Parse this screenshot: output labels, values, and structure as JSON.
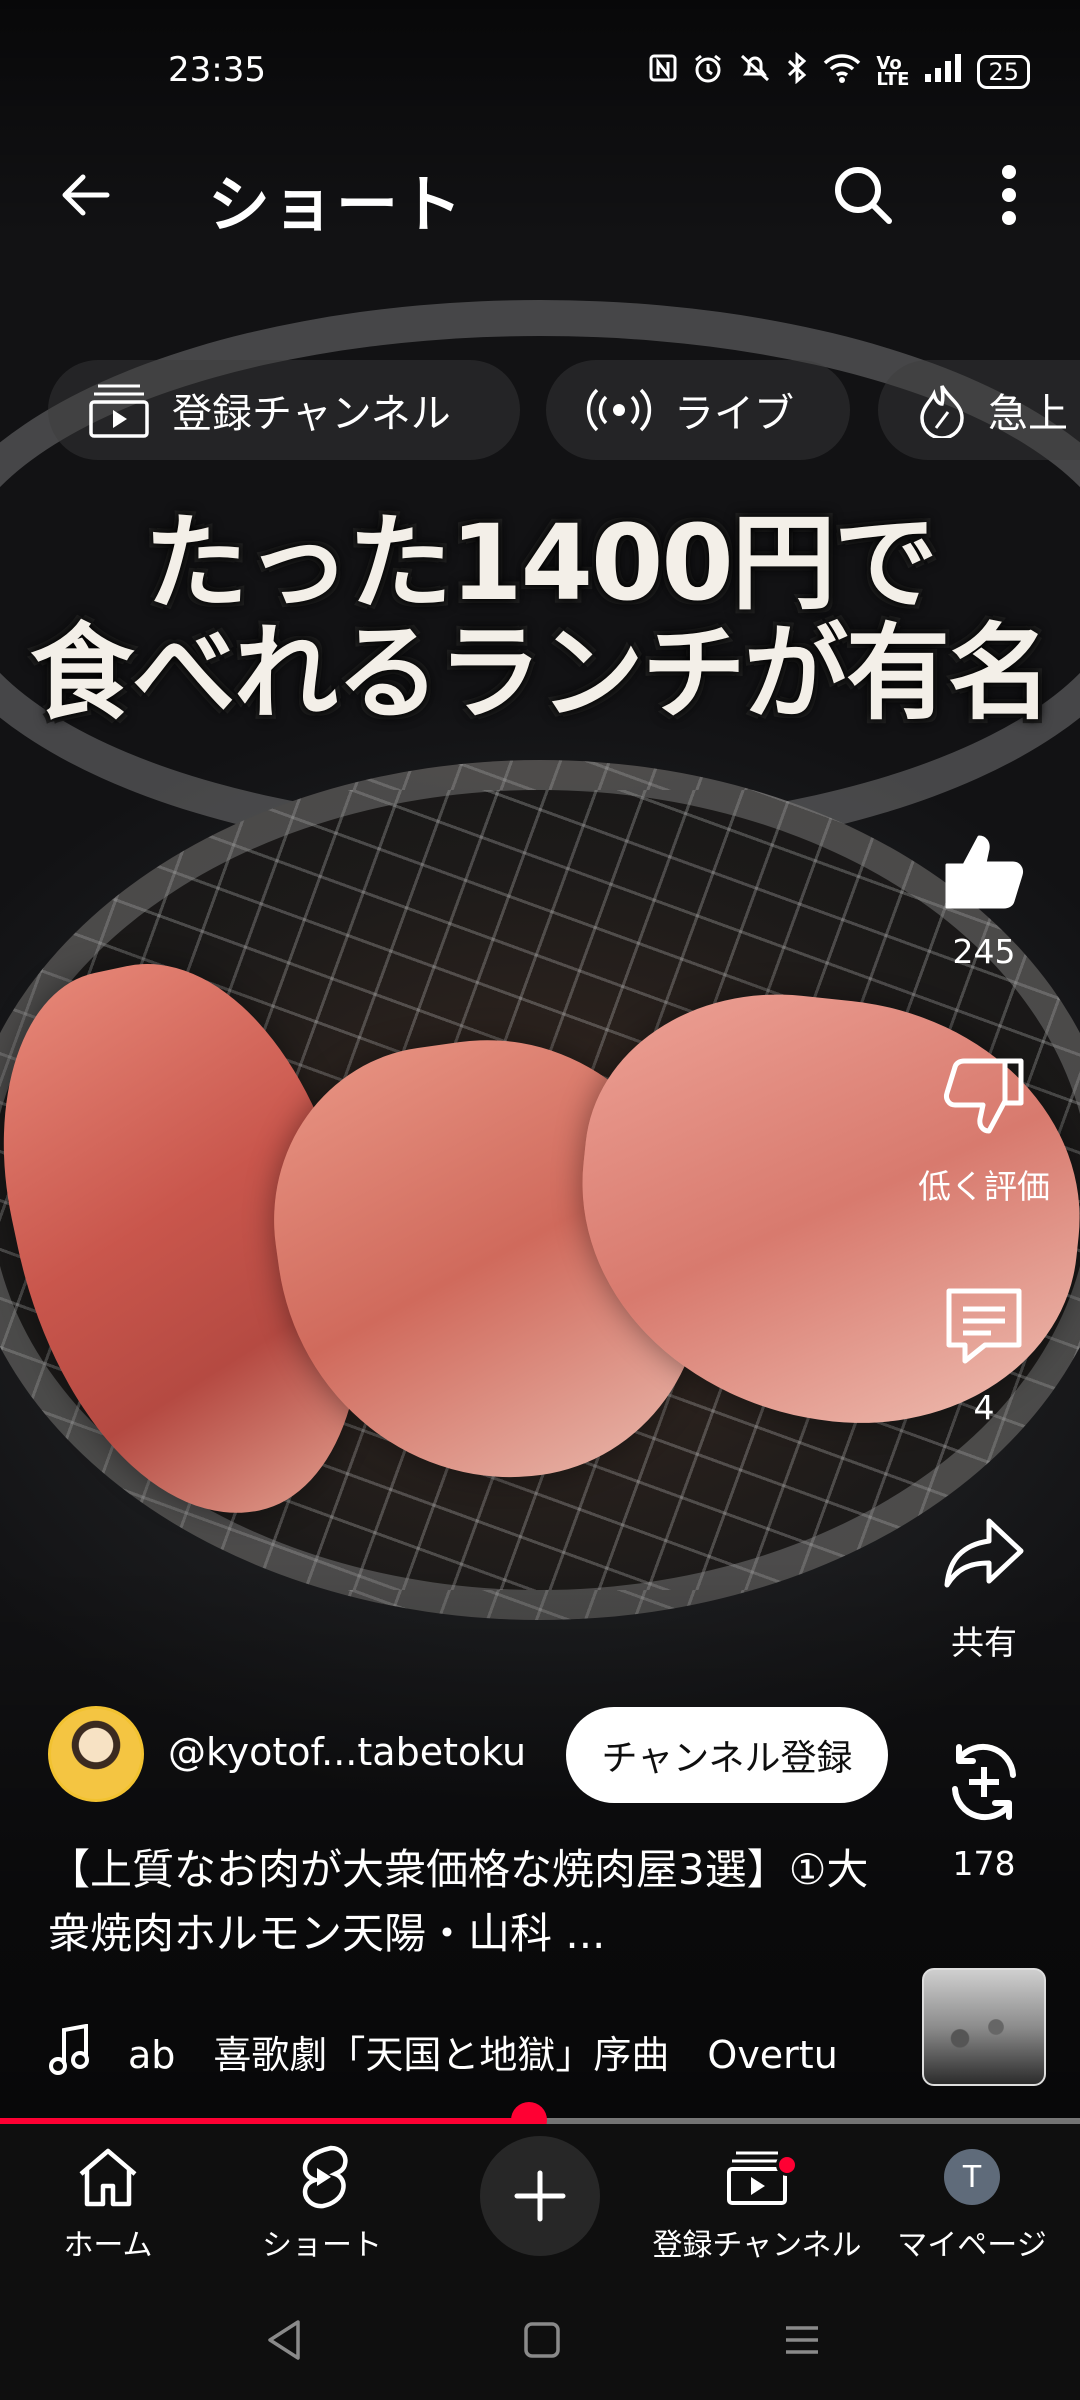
{
  "status_bar": {
    "time": "23:35",
    "battery": "25"
  },
  "top_bar": {
    "title": "ショート"
  },
  "chips": [
    {
      "label": "登録チャンネル",
      "icon": "subscriptions-icon"
    },
    {
      "label": "ライブ",
      "icon": "live-icon"
    },
    {
      "label": "急上",
      "icon": "trending-icon"
    }
  ],
  "video_caption": {
    "line1": "たった1400円で",
    "line2": "食べれるランチが有名"
  },
  "actions": {
    "like_count": "245",
    "dislike_label": "低く評価",
    "comment_count": "4",
    "share_label": "共有",
    "remix_count": "178"
  },
  "channel": {
    "handle": "@kyotof...tabetoku",
    "subscribe_label": "チャンネル登録"
  },
  "video": {
    "title": "【上質なお肉が大衆価格な焼肉屋3選】①大衆焼肉ホルモン天陽・山科 ..."
  },
  "music": {
    "text": "ab　喜歌劇「天国と地獄」序曲　Overtu"
  },
  "progress": {
    "fraction": 0.49
  },
  "bottom_nav": {
    "home": "ホーム",
    "shorts": "ショート",
    "subscriptions": "登録チャンネル",
    "mypage": "マイページ",
    "avatar_initial": "T"
  },
  "colors": {
    "accent": "#ff0033",
    "nav_bg": "#0f0f0f"
  }
}
